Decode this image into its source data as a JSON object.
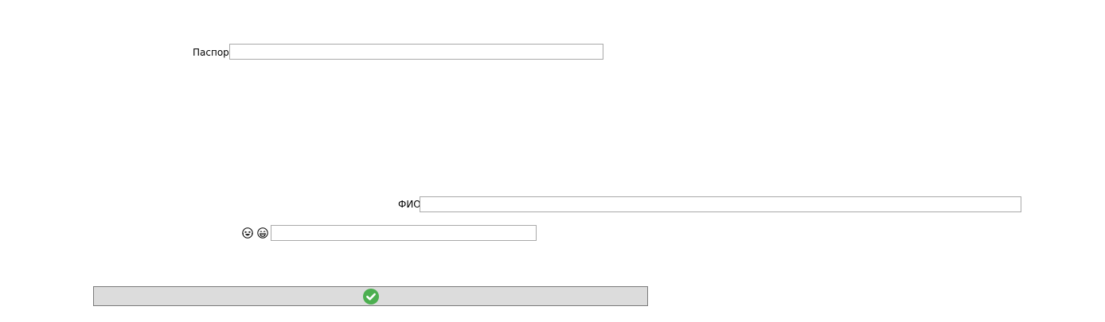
{
  "form": {
    "passport": {
      "label": "Паспорт",
      "value": "",
      "placeholder": ""
    },
    "fio": {
      "label": "ФИО",
      "value": "",
      "placeholder": ""
    },
    "emoji_field": {
      "icons": [
        "laughing-tears-icon",
        "grinning-face-icon"
      ],
      "value": "",
      "placeholder": ""
    },
    "submit": {
      "icon": "check-circle-icon",
      "icon_color": "#4caf50"
    }
  }
}
